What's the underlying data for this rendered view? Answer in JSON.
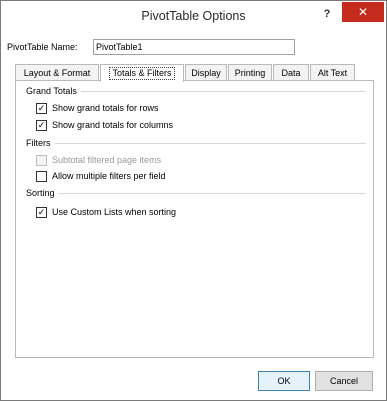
{
  "window": {
    "title": "PivotTable Options",
    "help_label": "?",
    "close_label": "✕"
  },
  "name_field": {
    "label": "PivotTable Name:",
    "value": "PivotTable1"
  },
  "tabs": [
    {
      "label": "Layout & Format",
      "active": false
    },
    {
      "label": "Totals & Filters",
      "active": true
    },
    {
      "label": "Display",
      "active": false
    },
    {
      "label": "Printing",
      "active": false
    },
    {
      "label": "Data",
      "active": false
    },
    {
      "label": "Alt Text",
      "active": false
    }
  ],
  "groups": {
    "grand_totals": {
      "title": "Grand Totals",
      "options": [
        {
          "label": "Show grand totals for rows",
          "checked": true,
          "enabled": true
        },
        {
          "label": "Show grand totals for columns",
          "checked": true,
          "enabled": true
        }
      ]
    },
    "filters": {
      "title": "Filters",
      "options": [
        {
          "label": "Subtotal filtered page items",
          "checked": false,
          "enabled": false
        },
        {
          "label": "Allow multiple filters per field",
          "checked": false,
          "enabled": true
        }
      ]
    },
    "sorting": {
      "title": "Sorting",
      "options": [
        {
          "label": "Use Custom Lists when sorting",
          "checked": true,
          "enabled": true
        }
      ]
    }
  },
  "buttons": {
    "ok": "OK",
    "cancel": "Cancel"
  },
  "colors": {
    "close_button": "#c42b1c",
    "default_button_border": "#3c7fb1"
  }
}
